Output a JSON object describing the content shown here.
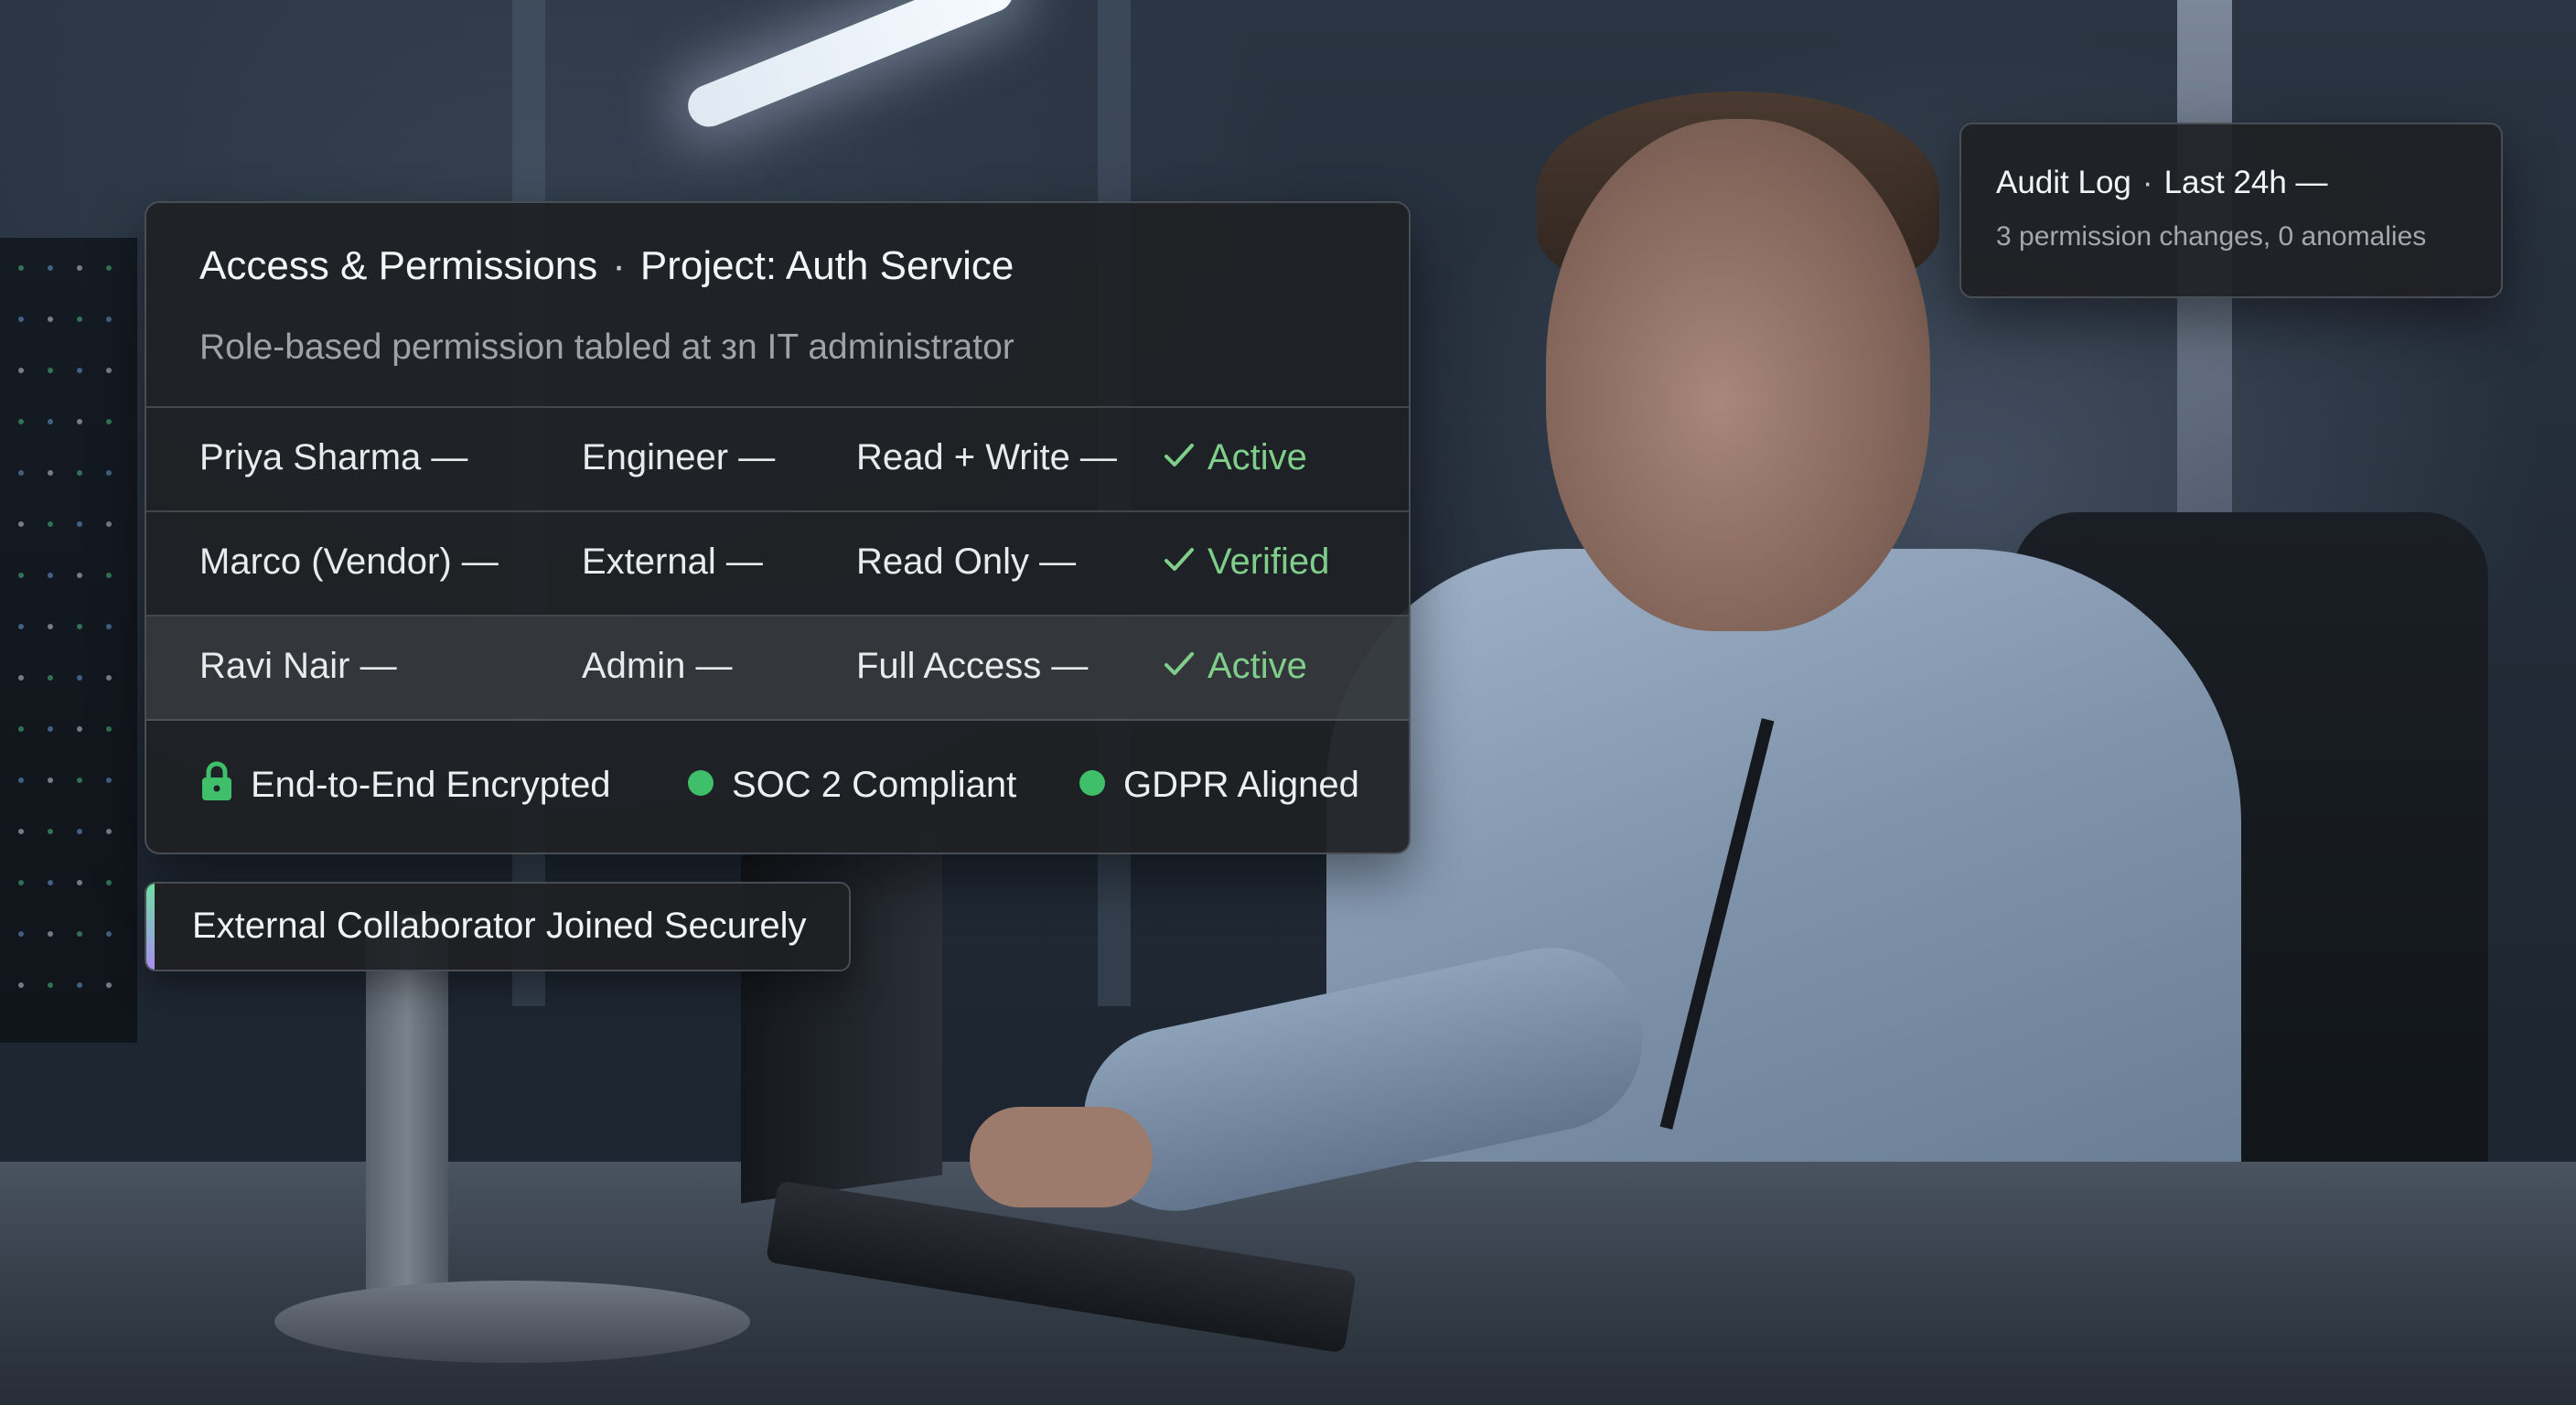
{
  "permissions_card": {
    "title": "Access & Permissions",
    "separator": "·",
    "project": "Project: Auth Service",
    "subtitle": "Role-based permission tabled at зn IT administrator",
    "rows": [
      {
        "name": "Priya Sharma —",
        "role": "Engineer —",
        "access": "Read + Write —",
        "status": "Active"
      },
      {
        "name": "Marco (Vendor) —",
        "role": "External —",
        "access": "Read Only —",
        "status": "Verified"
      },
      {
        "name": "Ravi Nair —",
        "role": "Admin —",
        "access": "Full Access —",
        "status": "Active"
      }
    ],
    "badges": {
      "encrypted": "End-to-End Encrypted",
      "soc2": "SOC 2 Compliant",
      "gdpr": "GDPR Aligned"
    },
    "status_color": "#7fcf8a",
    "badge_dot_color": "#3fbf6a"
  },
  "notification": {
    "text": "External Collaborator Joined Securely"
  },
  "audit_log": {
    "title": "Audit Log",
    "separator": "·",
    "period": "Last 24h —",
    "summary": "3 permission changes, 0 anomalies"
  },
  "icons": {
    "lock": "lock-icon",
    "check": "check-icon",
    "status_dot": "status-dot-icon"
  }
}
